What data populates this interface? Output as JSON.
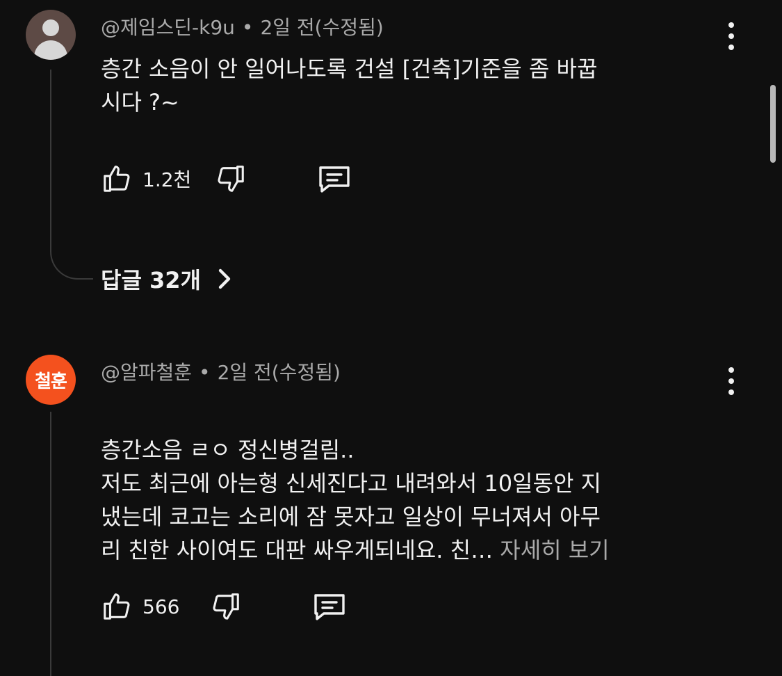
{
  "comments": [
    {
      "author": "@제임스딘-k9u",
      "separator": "•",
      "time": "2일 전(수정됨)",
      "text": "층간 소음이 안 일어나도록 건설 [건축]기준을 좀 바꿉\n시다 ?~",
      "likes": "1.2천",
      "replies": "답글 32개",
      "avatar_style": "default-person"
    },
    {
      "author": "@알파철훈",
      "separator": "•",
      "time": "2일 전(수정됨)",
      "avatar_text": "철훈",
      "text": "층간소음 ㄹㅇ 정신병걸림..\n저도 최근에 아는형 신세진다고 내려와서 10일동안 지\n냈는데 코고는 소리에 잠 못자고 일상이 무너져서 아무\n리 친한 사이여도 대판 싸우게되네요. 친…",
      "more": " 자세히 보기",
      "likes": "566"
    }
  ],
  "colors": {
    "background": "#0f0f0f",
    "text": "#f1f1f1",
    "secondary": "#aaaaaa",
    "avatar_orange": "#f4511e"
  },
  "icons": [
    "like-icon",
    "dislike-icon",
    "reply-icon",
    "more-vert-icon",
    "chevron-right-icon"
  ]
}
